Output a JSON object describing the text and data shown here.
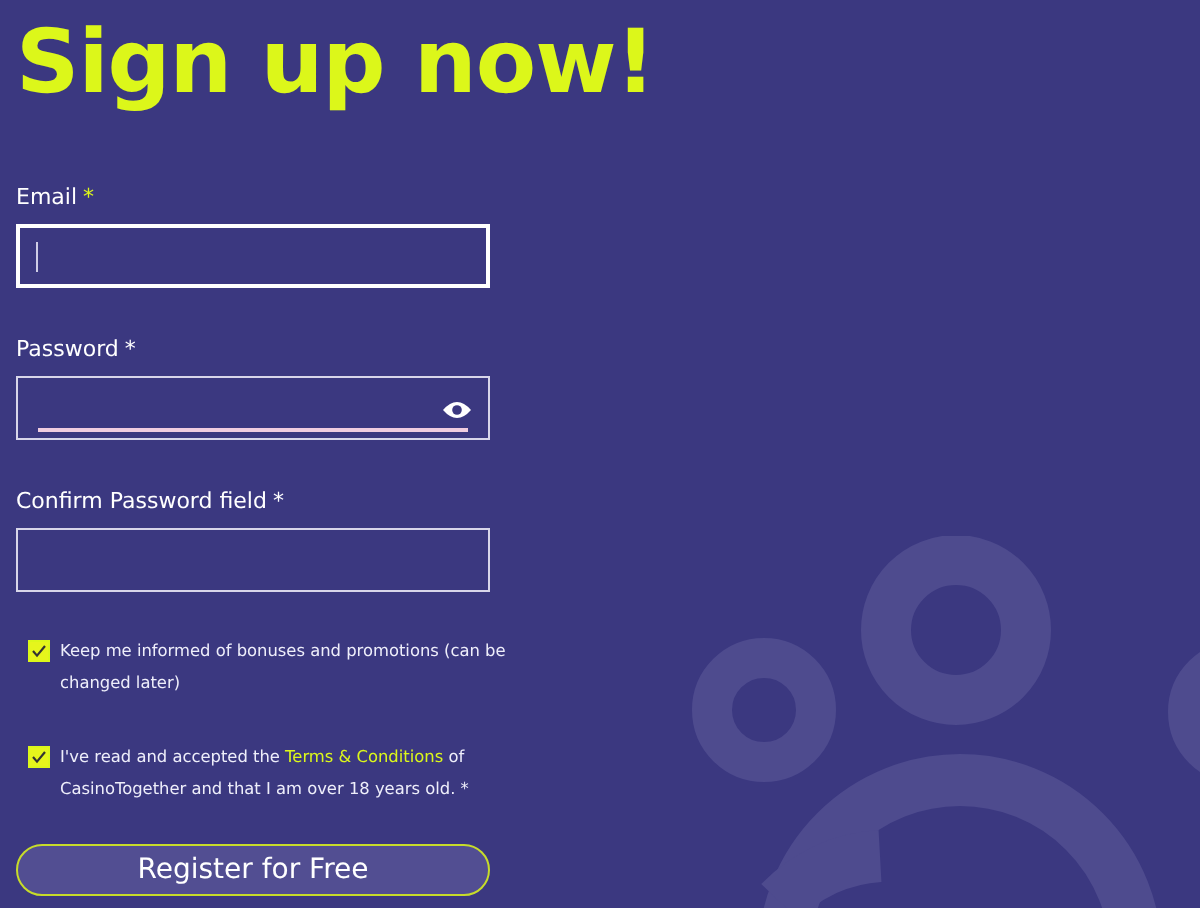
{
  "title": "Sign up now!",
  "fields": [
    {
      "kind": "text",
      "label": "Email",
      "required_mark": "*",
      "focused": true
    },
    {
      "kind": "password",
      "label": "Password",
      "required_mark": "*",
      "focused": false
    },
    {
      "kind": "text",
      "label": "Confirm Password field",
      "required_mark": "*",
      "focused": false
    }
  ],
  "checkboxes": [
    {
      "checked": true,
      "text": "Keep me informed of bonuses and promotions (can be changed later)"
    },
    {
      "checked": true,
      "text": "I've read and accepted the ",
      "link": "Terms & Conditions",
      "text_after": " of CasinoTogether and that I am over 18 years old. *"
    }
  ],
  "button": "Register for Free"
}
